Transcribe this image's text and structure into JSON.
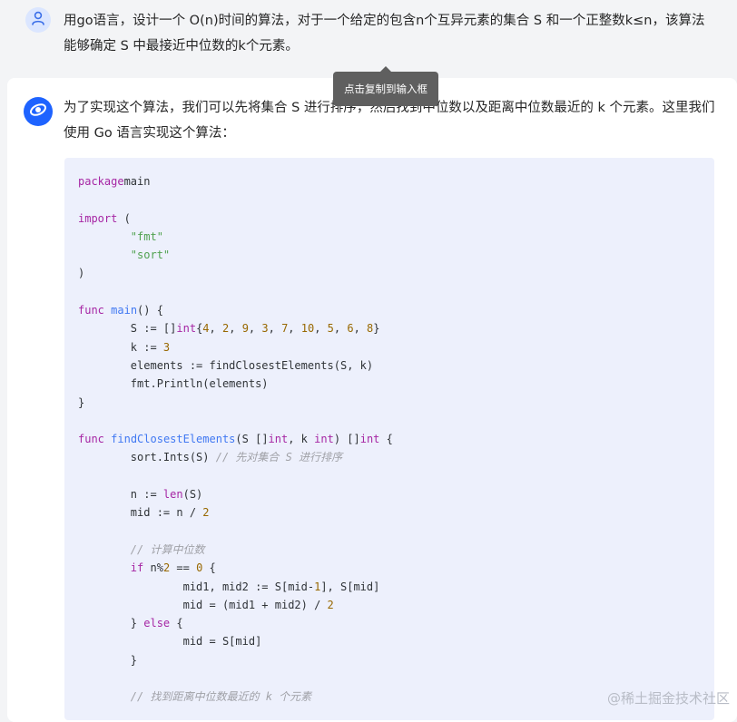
{
  "user_message": {
    "text": "用go语言，设计一个 O(n)时间的算法，对于一个给定的包含n个互异元素的集合 S 和一个正整数k≤n，该算法能够确定 S 中最接近中位数的k个元素。"
  },
  "tooltip": {
    "text": "点击复制到输入框"
  },
  "assistant_message": {
    "intro": "为了实现这个算法，我们可以先将集合 S 进行排序，然后找到中位数以及距离中位数最近的 k 个元素。这里我们使用 Go 语言实现这个算法：",
    "code_lines": [
      [
        [
          "kw",
          "package"
        ],
        [
          "",
          "main"
        ]
      ],
      [],
      [
        [
          "kw",
          "import"
        ],
        [
          "",
          " ("
        ]
      ],
      [
        [
          "",
          "        "
        ],
        [
          "str",
          "\"fmt\""
        ]
      ],
      [
        [
          "",
          "        "
        ],
        [
          "str",
          "\"sort\""
        ]
      ],
      [
        [
          "",
          ")"
        ]
      ],
      [],
      [
        [
          "kw",
          "func"
        ],
        [
          "",
          " "
        ],
        [
          "fn",
          "main"
        ],
        [
          "",
          "() {"
        ]
      ],
      [
        [
          "",
          "        S := []"
        ],
        [
          "kw",
          "int"
        ],
        [
          "",
          "{"
        ],
        [
          "num",
          "4"
        ],
        [
          ",",
          ""
        ],
        [
          "",
          " "
        ],
        [
          "num",
          "2"
        ],
        [
          "",
          ", "
        ],
        [
          "num",
          "9"
        ],
        [
          "",
          ", "
        ],
        [
          "num",
          "3"
        ],
        [
          "",
          ", "
        ],
        [
          "num",
          "7"
        ],
        [
          "",
          ", "
        ],
        [
          "num",
          "10"
        ],
        [
          "",
          ", "
        ],
        [
          "num",
          "5"
        ],
        [
          "",
          ", "
        ],
        [
          "num",
          "6"
        ],
        [
          "",
          ", "
        ],
        [
          "num",
          "8"
        ],
        [
          "",
          "}"
        ]
      ],
      [
        [
          "",
          "        k := "
        ],
        [
          "num",
          "3"
        ]
      ],
      [
        [
          "",
          "        elements := findClosestElements(S, k)"
        ]
      ],
      [
        [
          "",
          "        fmt.Println(elements)"
        ]
      ],
      [
        [
          "",
          "}"
        ]
      ],
      [],
      [
        [
          "kw",
          "func"
        ],
        [
          "",
          " "
        ],
        [
          "fn",
          "findClosestElements"
        ],
        [
          "",
          "(S []"
        ],
        [
          "kw",
          "int"
        ],
        [
          "",
          ", k "
        ],
        [
          "kw",
          "int"
        ],
        [
          "",
          ") []"
        ],
        [
          "kw",
          "int"
        ],
        [
          "",
          " {"
        ]
      ],
      [
        [
          "",
          "        sort.Ints(S) "
        ],
        [
          "cm",
          "// 先对集合 S 进行排序"
        ]
      ],
      [],
      [
        [
          "",
          "        n := "
        ],
        [
          "kw",
          "len"
        ],
        [
          "",
          "(S)"
        ]
      ],
      [
        [
          "",
          "        mid := n / "
        ],
        [
          "num",
          "2"
        ]
      ],
      [],
      [
        [
          "",
          "        "
        ],
        [
          "cm",
          "// 计算中位数"
        ]
      ],
      [
        [
          "",
          "        "
        ],
        [
          "kw",
          "if"
        ],
        [
          "",
          " n%"
        ],
        [
          "num",
          "2"
        ],
        [
          "",
          " == "
        ],
        [
          "num",
          "0"
        ],
        [
          "",
          " {"
        ]
      ],
      [
        [
          "",
          "                mid1, mid2 := S[mid-"
        ],
        [
          "num",
          "1"
        ],
        [
          "",
          "], S[mid]"
        ]
      ],
      [
        [
          "",
          "                mid = (mid1 + mid2) / "
        ],
        [
          "num",
          "2"
        ]
      ],
      [
        [
          "",
          "        } "
        ],
        [
          "kw",
          "else"
        ],
        [
          "",
          " {"
        ]
      ],
      [
        [
          "",
          "                mid = S[mid]"
        ]
      ],
      [
        [
          "",
          "        }"
        ]
      ],
      [],
      [
        [
          "",
          "        "
        ],
        [
          "cm",
          "// 找到距离中位数最近的 k 个元素"
        ]
      ]
    ]
  },
  "watermark": {
    "text": "@稀土掘金技术社区"
  },
  "icons": {
    "user_avatar": "user-icon",
    "bot_avatar": "assistant-logo-icon"
  },
  "colors": {
    "accent": "#1e63ff",
    "code_bg": "#edf0fc"
  }
}
